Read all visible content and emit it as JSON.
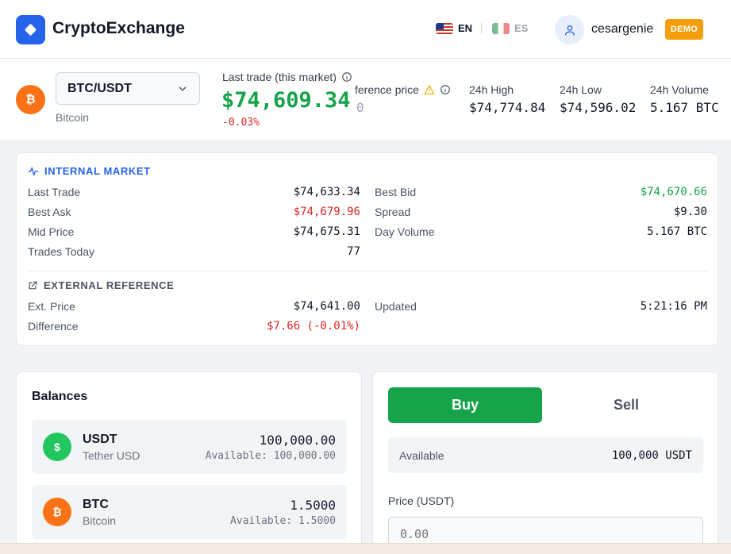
{
  "header": {
    "brand": "CryptoExchange",
    "languages": [
      {
        "code": "EN",
        "active": true
      },
      {
        "code": "ES",
        "active": false
      }
    ],
    "username": "cesargenie",
    "badge": "DEMO"
  },
  "market": {
    "pair": "BTC/USDT",
    "coin_name": "Bitcoin",
    "coin_symbol": "₿",
    "last_trade_label": "Last trade (this market)",
    "last_trade_price": "$74,609.34",
    "last_trade_change": "-0.03%",
    "reference_label": "Reference price",
    "reference_label_visible": "ference price",
    "reference_value_visible": "0",
    "stats": [
      {
        "label": "24h High",
        "value": "$74,774.84"
      },
      {
        "label": "24h Low",
        "value": "$74,596.02"
      },
      {
        "label": "24h Volume",
        "value": "5.167 BTC"
      }
    ]
  },
  "internal_market": {
    "title": "INTERNAL MARKET",
    "left": [
      {
        "label": "Last Trade",
        "value": "$74,633.34"
      },
      {
        "label": "Best Ask",
        "value": "$74,679.96"
      },
      {
        "label": "Mid Price",
        "value": "$74,675.31"
      },
      {
        "label": "Trades Today",
        "value": "77"
      }
    ],
    "right": [
      {
        "label": "Best Bid",
        "value": "$74,670.66"
      },
      {
        "label": "Spread",
        "value": "$9.30"
      },
      {
        "label": "Day Volume",
        "value": "5.167 BTC"
      }
    ]
  },
  "external_reference": {
    "title": "EXTERNAL REFERENCE",
    "ext_price_label": "Ext. Price",
    "ext_price_value": "$74,641.00",
    "difference_label": "Difference",
    "difference_value": "$7.66 (-0.01%)",
    "updated_label": "Updated",
    "updated_value": "5:21:16 PM"
  },
  "balances": {
    "title": "Balances",
    "items": [
      {
        "symbol": "USDT",
        "name": "Tether USD",
        "amount": "100,000.00",
        "available": "Available: 100,000.00",
        "icon_glyph": "$",
        "color": "#22c55e"
      },
      {
        "symbol": "BTC",
        "name": "Bitcoin",
        "amount": "1.5000",
        "available": "Available: 1.5000",
        "icon_glyph": "₿",
        "color": "#f97316"
      }
    ]
  },
  "trade": {
    "buy_label": "Buy",
    "sell_label": "Sell",
    "available_label": "Available",
    "available_value": "100,000 USDT",
    "price_label": "Price (USDT)",
    "price_placeholder": "0.00"
  },
  "colors": {
    "accent": "#2563eb",
    "positive": "#16a34a",
    "negative": "#dc2626",
    "badge": "#f59e0b",
    "btc": "#f97316"
  },
  "icons": {
    "logo": "diamond-logo-icon",
    "user": "user-icon",
    "info": "info-icon",
    "warning": "warning-icon",
    "chevron": "chevron-down-icon",
    "activity": "activity-icon",
    "external": "external-link-icon"
  }
}
